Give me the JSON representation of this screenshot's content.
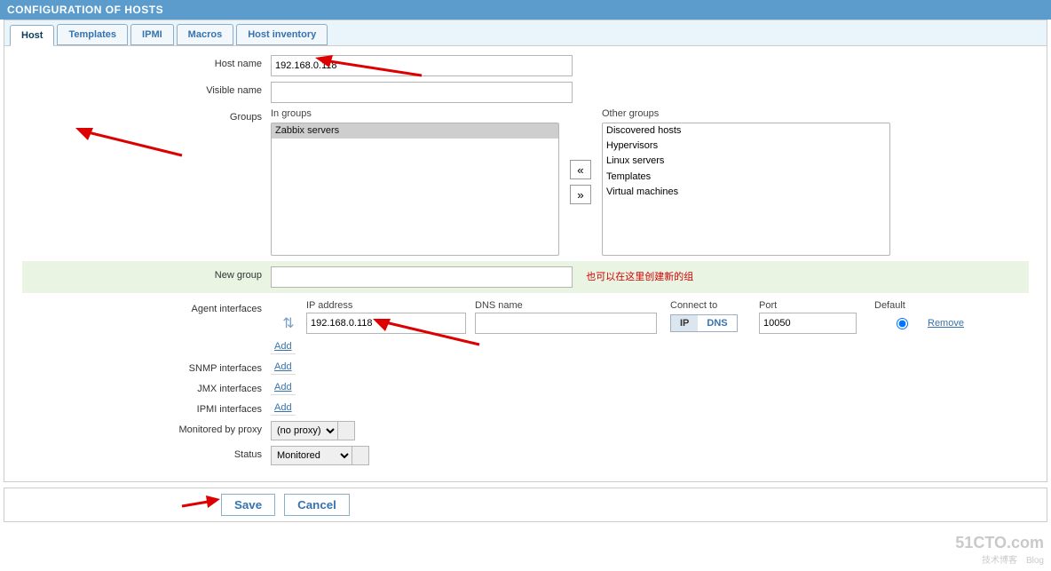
{
  "header": {
    "title": "CONFIGURATION OF HOSTS"
  },
  "tabs": [
    "Host",
    "Templates",
    "IPMI",
    "Macros",
    "Host inventory"
  ],
  "labels": {
    "host_name": "Host name",
    "visible_name": "Visible name",
    "groups": "Groups",
    "in_groups": "In groups",
    "other_groups": "Other groups",
    "new_group": "New group",
    "agent_if": "Agent interfaces",
    "snmp_if": "SNMP interfaces",
    "jmx_if": "JMX interfaces",
    "ipmi_if": "IPMI interfaces",
    "mon_proxy": "Monitored by proxy",
    "status": "Status",
    "ip_address": "IP address",
    "dns_name": "DNS name",
    "connect_to": "Connect to",
    "port": "Port",
    "default": "Default",
    "ip_btn": "IP",
    "dns_btn": "DNS",
    "remove": "Remove",
    "add": "Add",
    "save": "Save",
    "cancel": "Cancel"
  },
  "values": {
    "host_name": "192.168.0.118",
    "visible_name": "",
    "in_groups": [
      "Zabbix servers"
    ],
    "other_groups": [
      "Discovered hosts",
      "Hypervisors",
      "Linux servers",
      "Templates",
      "Virtual machines"
    ],
    "new_group": "",
    "new_group_note": "也可以在这里创建新的组",
    "agent_ip": "192.168.0.118",
    "agent_dns": "",
    "agent_port": "10050",
    "proxy": "(no proxy)",
    "status": "Monitored"
  },
  "watermark": {
    "main": "51CTO.com",
    "sub": "技术博客　Blog"
  }
}
